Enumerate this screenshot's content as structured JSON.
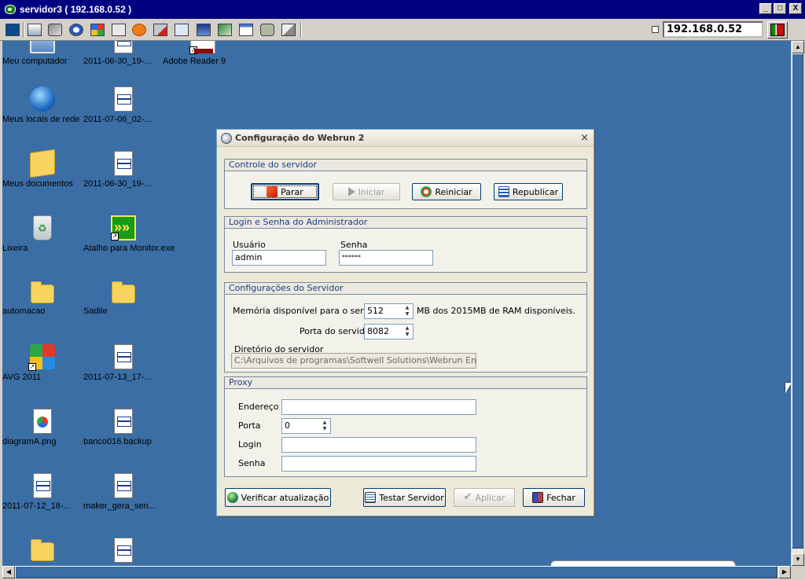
{
  "window": {
    "title": "servidor3 ( 192.168.0.52 )",
    "controls": [
      "_",
      "□",
      "X"
    ]
  },
  "toolbar": {
    "icons": [
      "connection-info-icon",
      "options-icon",
      "tools-icon",
      "refresh-icon",
      "windows-key-icon",
      "ctrl-alt-del-icon",
      "alert-icon",
      "disconnect-icon",
      "fullscreen-icon",
      "screen-icon",
      "transfer-icon",
      "clipboard-icon",
      "chat-icon",
      "multiple-windows-icon"
    ],
    "host_value": "192.168.0.52"
  },
  "desktop": {
    "icons": [
      {
        "label": "Meu computador",
        "type": "computer"
      },
      {
        "label": "2011-06-30_19-...",
        "type": "doc"
      },
      {
        "label": "Adobe Reader 9",
        "type": "pdf"
      },
      {
        "label": "Meus locais de rede",
        "type": "globe"
      },
      {
        "label": "2011-07-06_02-...",
        "type": "doc"
      },
      {
        "label": "Meus documentos",
        "type": "mydocs"
      },
      {
        "label": "2011-06-30_19-...",
        "type": "doc"
      },
      {
        "label": "Lixeira",
        "type": "trash"
      },
      {
        "label": "Atalho para Monitor.exe",
        "type": "monitor"
      },
      {
        "label": "automacao",
        "type": "folder"
      },
      {
        "label": "Sadile",
        "type": "folder"
      },
      {
        "label": "AVG 2011",
        "type": "avg"
      },
      {
        "label": "2011-07-13_17-...",
        "type": "doc"
      },
      {
        "label": "diagramA.png",
        "type": "png"
      },
      {
        "label": "banco016.backup",
        "type": "doc"
      },
      {
        "label": "2011-07-12_18-...",
        "type": "doc"
      },
      {
        "label": "maker_gera_sen...",
        "type": "doc"
      }
    ]
  },
  "dialog": {
    "title": "Configuração do Webrun 2",
    "close": "×",
    "server_control": {
      "header": "Controle do servidor",
      "stop": "Parar",
      "start": "Iniciar",
      "restart": "Reiniciar",
      "republish": "Republicar"
    },
    "admin": {
      "header": "Login e Senha do Administrador",
      "user_label": "Usuário",
      "user_value": "admin",
      "password_label": "Senha",
      "password_value": "******"
    },
    "server_config": {
      "header": "Configurações do Servidor",
      "memory_label": "Memória disponível para o servidor",
      "memory_value": "512",
      "memory_suffix": "MB dos 2015MB de RAM disponíveis.",
      "port_label": "Porta do servidor",
      "port_value": "8082",
      "dir_label": "Diretório do servidor",
      "dir_value": "C:\\Arquivos de programas\\Softwell Solutions\\Webrun Enterprise"
    },
    "proxy": {
      "header": "Proxy",
      "address_label": "Endereço",
      "address_value": "",
      "port_label": "Porta",
      "port_value": "0",
      "login_label": "Login",
      "login_value": "",
      "password_label": "Senha",
      "password_value": ""
    },
    "footer": {
      "check_updates": "Verificar atualização",
      "test_server": "Testar Servidor",
      "apply": "Aplicar",
      "close": "Fechar"
    }
  }
}
